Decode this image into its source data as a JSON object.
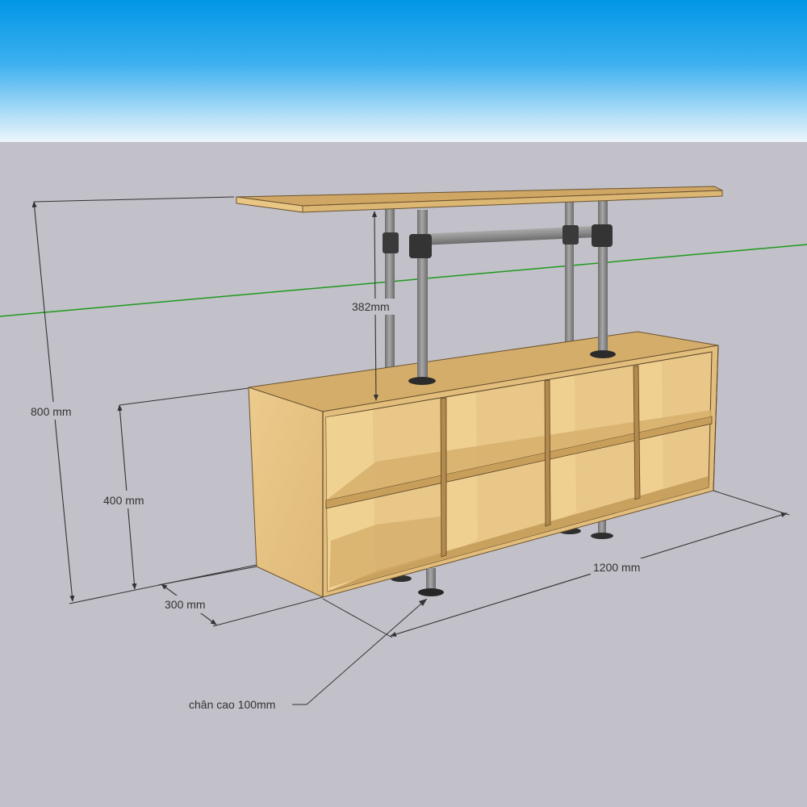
{
  "labels": {
    "total_height": "800 mm",
    "cabinet_height": "400 mm",
    "depth": "300 mm",
    "width": "1200 mm",
    "frame_height": "382mm",
    "leg_note": "chân cao 100mm"
  },
  "colors": {
    "sky_top": "#0096e6",
    "sky_bottom": "#eaf4fb",
    "ground": "#c2c0c8",
    "wood_light": "#ecc988",
    "wood_mid": "#d9b26e",
    "wood_dark": "#b58c4e",
    "pipe": "#8d8d8d",
    "fitting": "#3a3a3a",
    "axis_green": "#1e9a1e",
    "dimension_line": "#333333"
  }
}
